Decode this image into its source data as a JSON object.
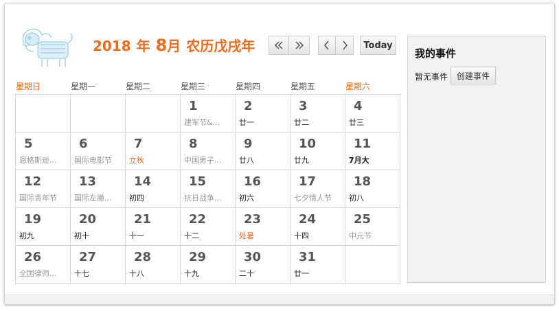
{
  "header": {
    "year": "2018",
    "year_suffix": "年",
    "month": "8",
    "month_suffix": "月",
    "lunar_year": "农历戊戌年"
  },
  "nav": {
    "prev_year_icon": "double-chevron-left-icon",
    "next_year_icon": "double-chevron-right-icon",
    "prev_month_icon": "chevron-left-icon",
    "next_month_icon": "chevron-right-icon",
    "today_label": "Today"
  },
  "weekdays": [
    "星期日",
    "星期一",
    "星期二",
    "星期三",
    "星期四",
    "星期五",
    "星期六"
  ],
  "days": [
    {
      "num": "",
      "sub": "",
      "style": ""
    },
    {
      "num": "",
      "sub": "",
      "style": ""
    },
    {
      "num": "",
      "sub": "",
      "style": ""
    },
    {
      "num": "1",
      "sub": "建军节&...",
      "style": "holiday"
    },
    {
      "num": "2",
      "sub": "廿一",
      "style": "lunar"
    },
    {
      "num": "3",
      "sub": "廿二",
      "style": "lunar"
    },
    {
      "num": "4",
      "sub": "廿三",
      "style": "lunar"
    },
    {
      "num": "5",
      "sub": "恩格斯逝...",
      "style": "holiday"
    },
    {
      "num": "6",
      "sub": "国际电影节",
      "style": "holiday"
    },
    {
      "num": "7",
      "sub": "立秋",
      "style": "term"
    },
    {
      "num": "8",
      "sub": "中国男子...",
      "style": "holiday"
    },
    {
      "num": "9",
      "sub": "廿八",
      "style": "lunar"
    },
    {
      "num": "10",
      "sub": "廿九",
      "style": "lunar"
    },
    {
      "num": "11",
      "sub": "7月大",
      "style": "month"
    },
    {
      "num": "12",
      "sub": "国际青年节",
      "style": "holiday"
    },
    {
      "num": "13",
      "sub": "国际左撇...",
      "style": "holiday"
    },
    {
      "num": "14",
      "sub": "初四",
      "style": "lunar"
    },
    {
      "num": "15",
      "sub": "抗日战争...",
      "style": "holiday"
    },
    {
      "num": "16",
      "sub": "初六",
      "style": "lunar"
    },
    {
      "num": "17",
      "sub": "七夕情人节",
      "style": "holiday"
    },
    {
      "num": "18",
      "sub": "初八",
      "style": "lunar"
    },
    {
      "num": "19",
      "sub": "初九",
      "style": "lunar"
    },
    {
      "num": "20",
      "sub": "初十",
      "style": "lunar"
    },
    {
      "num": "21",
      "sub": "十一",
      "style": "lunar"
    },
    {
      "num": "22",
      "sub": "十二",
      "style": "lunar"
    },
    {
      "num": "23",
      "sub": "处暑",
      "style": "term"
    },
    {
      "num": "24",
      "sub": "十四",
      "style": "lunar"
    },
    {
      "num": "25",
      "sub": "中元节",
      "style": "holiday"
    },
    {
      "num": "26",
      "sub": "全国律师...",
      "style": "holiday"
    },
    {
      "num": "27",
      "sub": "十七",
      "style": "lunar"
    },
    {
      "num": "28",
      "sub": "十八",
      "style": "lunar"
    },
    {
      "num": "29",
      "sub": "十九",
      "style": "lunar"
    },
    {
      "num": "30",
      "sub": "二十",
      "style": "lunar"
    },
    {
      "num": "31",
      "sub": "廿一",
      "style": "lunar"
    },
    {
      "num": "",
      "sub": "",
      "style": ""
    }
  ],
  "events_panel": {
    "title": "我的事件",
    "empty_text": "暂无事件",
    "create_label": "创建事件"
  },
  "colors": {
    "accent": "#f26a1b",
    "logo": "#a9d4e8"
  },
  "logo_icon": "paper-cut-dog-icon"
}
